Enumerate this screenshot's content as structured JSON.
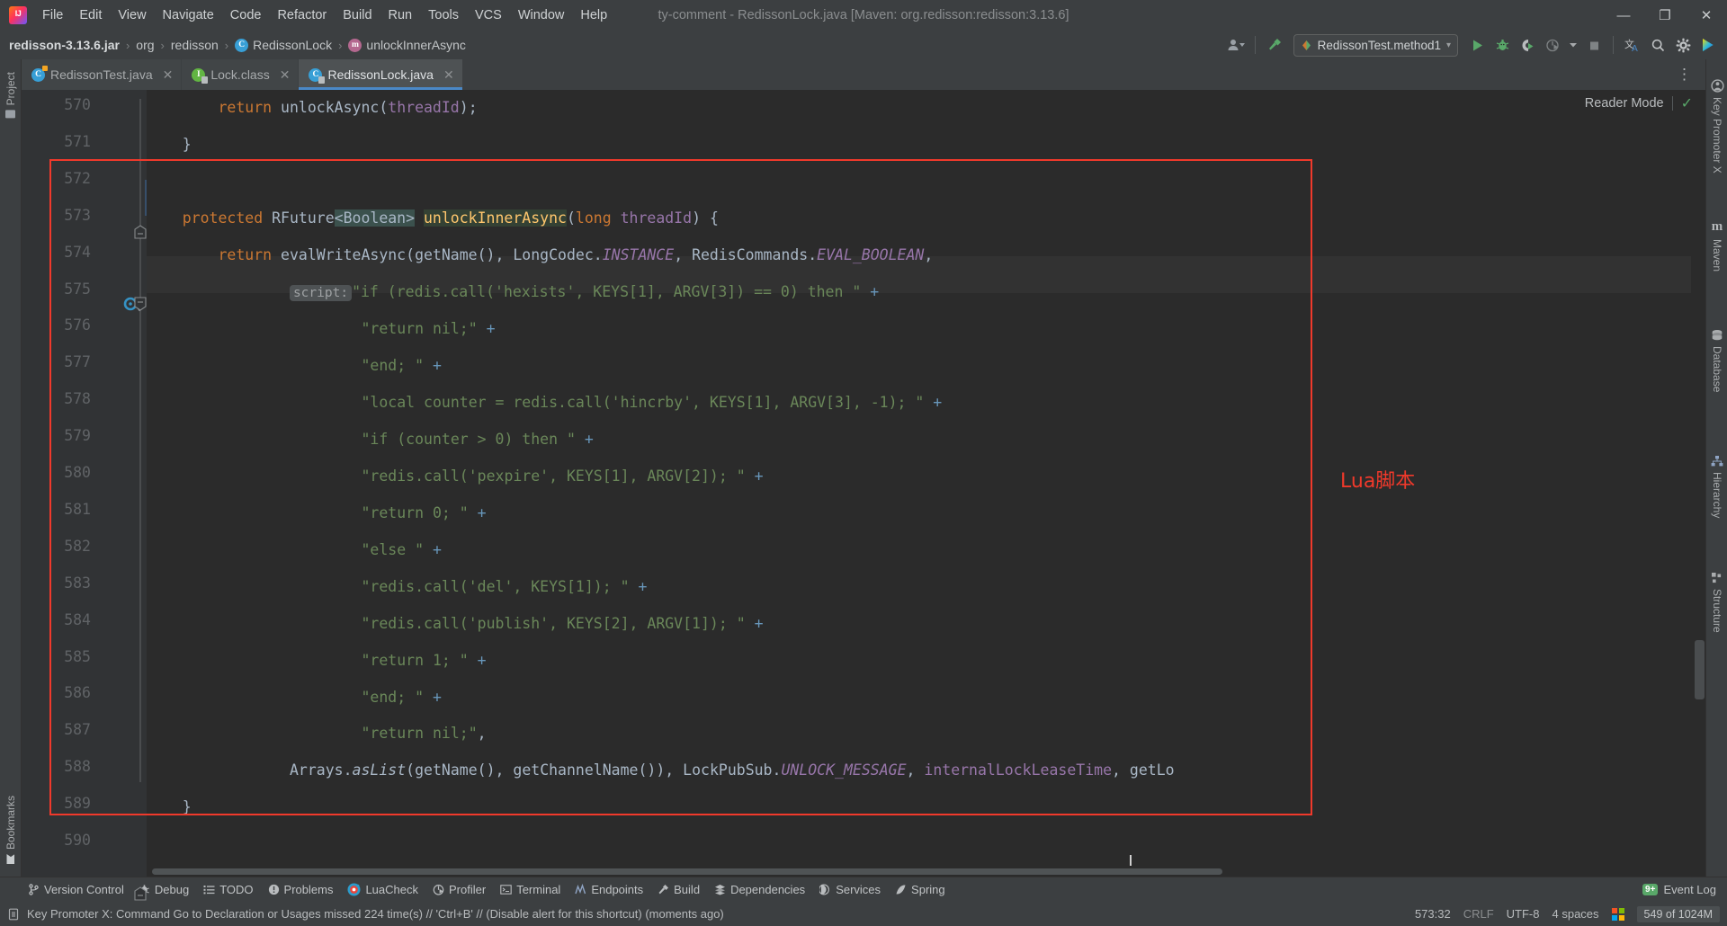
{
  "window": {
    "title": "ty-comment - RedissonLock.java [Maven: org.redisson:redisson:3.13.6]",
    "minimize": "—",
    "maximize": "❐",
    "close": "✕"
  },
  "menu": [
    {
      "label": "File"
    },
    {
      "label": "Edit"
    },
    {
      "label": "View"
    },
    {
      "label": "Navigate"
    },
    {
      "label": "Code"
    },
    {
      "label": "Refactor"
    },
    {
      "label": "Build"
    },
    {
      "label": "Run"
    },
    {
      "label": "Tools"
    },
    {
      "label": "VCS"
    },
    {
      "label": "Window"
    },
    {
      "label": "Help"
    }
  ],
  "breadcrumb": {
    "items": [
      {
        "label": "redisson-3.13.6.jar",
        "icon": "jar-icon"
      },
      {
        "label": "org",
        "icon": ""
      },
      {
        "label": "redisson",
        "icon": ""
      },
      {
        "label": "RedissonLock",
        "icon": "class-icon"
      },
      {
        "label": "unlockInnerAsync",
        "icon": "method-icon"
      }
    ],
    "separator": "›"
  },
  "run_config": {
    "label": "RedissonTest.method1",
    "chevron": "▾"
  },
  "toolbar_icons": [
    {
      "name": "user-account-icon"
    },
    {
      "name": "build-hammer-icon"
    },
    {
      "name": "run-icon"
    },
    {
      "name": "debug-icon"
    },
    {
      "name": "run-with-coverage-icon"
    },
    {
      "name": "profiler-icon"
    },
    {
      "name": "more-run-chevron-icon"
    },
    {
      "name": "stop-icon"
    },
    {
      "name": "translate-icon"
    },
    {
      "name": "search-everywhere-icon"
    },
    {
      "name": "settings-gear-icon"
    },
    {
      "name": "ide-assistant-icon"
    }
  ],
  "left_toolstrip": [
    {
      "label": "Project",
      "icon": "project-folder-icon"
    },
    {
      "label": "Bookmarks",
      "icon": "bookmark-icon"
    }
  ],
  "right_toolstrip": [
    {
      "label": "Key Promoter X",
      "icon": "key-promoter-icon"
    },
    {
      "label": "Maven",
      "icon": "maven-icon"
    },
    {
      "label": "Database",
      "icon": "database-icon"
    },
    {
      "label": "Hierarchy",
      "icon": "hierarchy-icon"
    },
    {
      "label": "Structure",
      "icon": "structure-icon"
    }
  ],
  "editor_tabs": [
    {
      "label": "RedissonTest.java",
      "icon": "java-class-icon",
      "active": false,
      "close": "✕"
    },
    {
      "label": "Lock.class",
      "icon": "java-interface-icon",
      "active": false,
      "close": "✕"
    },
    {
      "label": "RedissonLock.java",
      "icon": "java-class-icon",
      "active": true,
      "close": "✕"
    }
  ],
  "tabbar_overflow": "⋮",
  "reader_mode": {
    "label": "Reader Mode",
    "check": "✓"
  },
  "annotation": {
    "label": "Lua脚本",
    "color": "#f0392b"
  },
  "editor": {
    "first_line": 570,
    "line_numbers": [
      570,
      571,
      572,
      573,
      574,
      575,
      576,
      577,
      578,
      579,
      580,
      581,
      582,
      583,
      584,
      585,
      586,
      587,
      588,
      589,
      590
    ],
    "param_hint": "script:",
    "lines": [
      "        return unlockAsync(threadId);",
      "    }",
      "",
      "    protected RFuture<Boolean> unlockInnerAsync(long threadId) {",
      "        return evalWriteAsync(getName(), LongCodec.INSTANCE, RedisCommands.EVAL_BOOLEAN,",
      "                \"if (redis.call('hexists', KEYS[1], ARGV[3]) == 0) then \" +",
      "                        \"return nil;\" +",
      "                        \"end; \" +",
      "                        \"local counter = redis.call('hincrby', KEYS[1], ARGV[3], -1); \" +",
      "                        \"if (counter > 0) then \" +",
      "                        \"redis.call('pexpire', KEYS[1], ARGV[2]); \" +",
      "                        \"return 0; \" +",
      "                        \"else \" +",
      "                        \"redis.call('del', KEYS[1]); \" +",
      "                        \"redis.call('publish', KEYS[2], ARGV[1]); \" +",
      "                        \"return 1; \" +",
      "                        \"end; \" +",
      "                        \"return nil;\",",
      "                Arrays.asList(getName(), getChannelName()), LockPubSub.UNLOCK_MESSAGE, internalLockLeaseTime, getLo",
      "    }",
      ""
    ]
  },
  "tool_windows": [
    {
      "label": "Version Control",
      "icon": "branch-icon"
    },
    {
      "label": "Debug",
      "icon": "debug-bug-icon"
    },
    {
      "label": "TODO",
      "icon": "todo-list-icon"
    },
    {
      "label": "Problems",
      "icon": "problems-icon"
    },
    {
      "label": "LuaCheck",
      "icon": "luacheck-icon"
    },
    {
      "label": "Profiler",
      "icon": "profiler-icon"
    },
    {
      "label": "Terminal",
      "icon": "terminal-icon"
    },
    {
      "label": "Endpoints",
      "icon": "endpoints-icon"
    },
    {
      "label": "Build",
      "icon": "build-hammer-icon"
    },
    {
      "label": "Dependencies",
      "icon": "dependencies-icon"
    },
    {
      "label": "Services",
      "icon": "services-icon"
    },
    {
      "label": "Spring",
      "icon": "spring-leaf-icon"
    }
  ],
  "event_log": {
    "badge": "9+",
    "label": "Event Log"
  },
  "status": {
    "message": "Key Promoter X: Command Go to Declaration or Usages missed 224 time(s) // 'Ctrl+B' // (Disable alert for this shortcut) (moments ago)",
    "message_icon": "notification-icon",
    "caret_position": "573:32",
    "line_separator": "CRLF",
    "encoding": "UTF-8",
    "indent": "4 spaces",
    "os_icon": "windows-logo-icon",
    "memory": "549 of 1024M"
  }
}
